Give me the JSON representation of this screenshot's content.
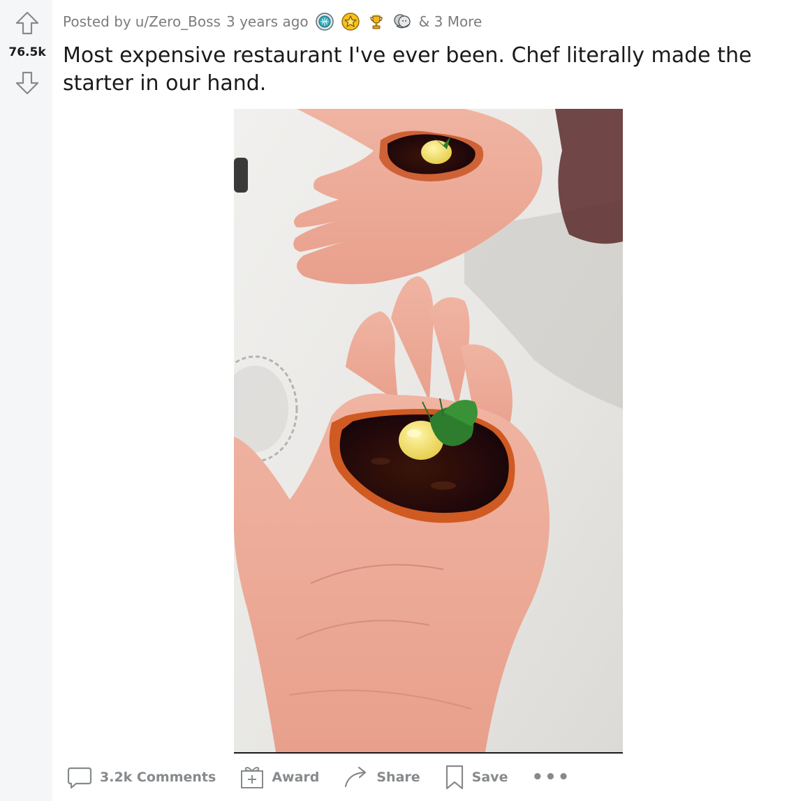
{
  "vote": {
    "score": "76.5k"
  },
  "meta": {
    "posted_by": "Posted by",
    "username": "u/Zero_Boss",
    "time": "3 years ago",
    "awards": [
      "globe-award-icon",
      "star-award-icon",
      "trophy-award-icon",
      "hug-award-icon"
    ],
    "more_awards": "& 3 More"
  },
  "post": {
    "title": "Most expensive restaurant I've ever been. Chef literally made the starter in our hand."
  },
  "actions": {
    "comments": "3.2k Comments",
    "award": "Award",
    "share": "Share",
    "save": "Save",
    "more": "•••"
  },
  "colors": {
    "rail_bg": "#f5f6f8",
    "meta_text": "#7c7c7c",
    "title_text": "#1a1a1b",
    "action_text": "#878a8c"
  }
}
